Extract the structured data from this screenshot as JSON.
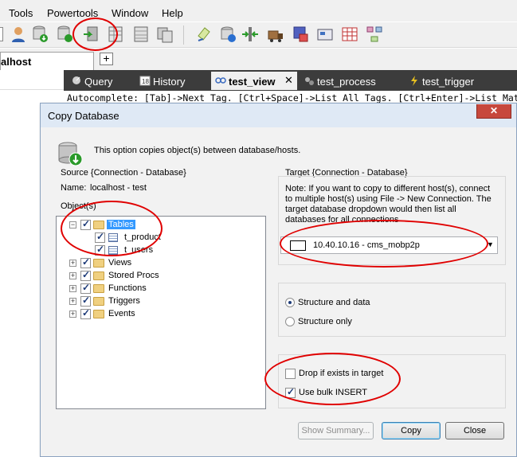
{
  "menu": [
    "Tools",
    "Powertools",
    "Window",
    "Help"
  ],
  "connection_tab": "alhost",
  "query_tabs": [
    "Query",
    "History",
    "test_view",
    "test_process",
    "test_trigger"
  ],
  "autocomplete_text": "Autocomplete: [Tab]->Next Tag. [Ctrl+Space]->List All Tags. [Ctrl+Enter]->List Matching Tags. [Ctr",
  "dialog": {
    "title": "Copy Database",
    "close_glyph": "✕",
    "description": "This option copies object(s) between database/hosts.",
    "source_label": "Source {Connection - Database}",
    "name_label": "Name:",
    "name_value": "localhost - test",
    "objects_label": "Object(s)",
    "tree": [
      {
        "label": "Tables",
        "expanded": true,
        "checked": true,
        "selected": true,
        "children": [
          "t_product",
          "t_users"
        ]
      },
      {
        "label": "Views",
        "checked": true
      },
      {
        "label": "Stored Procs",
        "checked": true
      },
      {
        "label": "Functions",
        "checked": true
      },
      {
        "label": "Triggers",
        "checked": true
      },
      {
        "label": "Events",
        "checked": true
      }
    ],
    "target_label": "Target {Connection - Database}",
    "note_lines": [
      "Note: If you want to copy to different host(s), connect",
      "to multiple host(s) using  File -> New Connection. The",
      "target database dropdown would then list all",
      "databases for all connections"
    ],
    "target_value": "10.40.10.16 - cms_mobp2p",
    "structure_and_data": "Structure and data",
    "structure_only": "Structure only",
    "structure_choice": "Structure and data",
    "drop_if_exists": "Drop if exists in target",
    "drop_checked": false,
    "bulk_insert": "Use bulk INSERT",
    "bulk_checked": true,
    "buttons": {
      "summary": "Show Summary...",
      "copy": "Copy",
      "close": "Close"
    }
  },
  "colors": {
    "annotation": "#e00000",
    "tab_dark": "#3c3c3c",
    "selection": "#3399ff"
  }
}
